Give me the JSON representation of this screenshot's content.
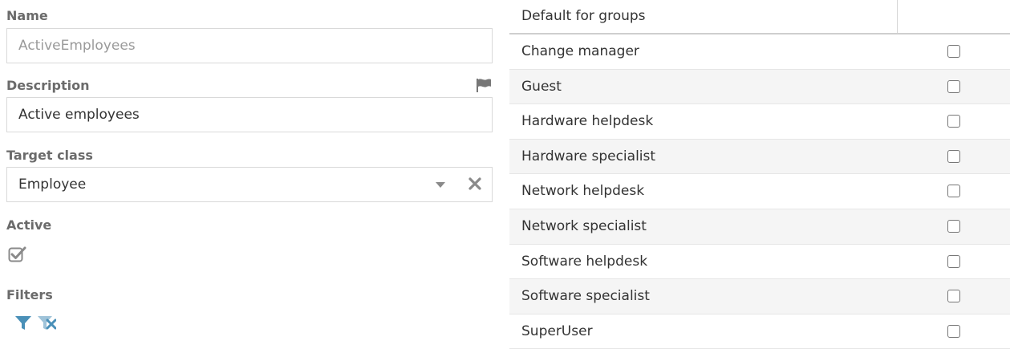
{
  "form": {
    "name": {
      "label": "Name",
      "value": "ActiveEmployees"
    },
    "description": {
      "label": "Description",
      "value": "Active employees"
    },
    "target_class": {
      "label": "Target class",
      "value": "Employee"
    },
    "active": {
      "label": "Active",
      "checked": true
    },
    "filters": {
      "label": "Filters"
    }
  },
  "grid": {
    "header": "Default for groups",
    "rows": [
      {
        "name": "Change manager",
        "checked": false
      },
      {
        "name": "Guest",
        "checked": false
      },
      {
        "name": "Hardware helpdesk",
        "checked": false
      },
      {
        "name": "Hardware specialist",
        "checked": false
      },
      {
        "name": "Network helpdesk",
        "checked": false
      },
      {
        "name": "Network specialist",
        "checked": false
      },
      {
        "name": "Software helpdesk",
        "checked": false
      },
      {
        "name": "Software specialist",
        "checked": false
      },
      {
        "name": "SuperUser",
        "checked": false
      }
    ]
  },
  "colors": {
    "accent": "#4a90b8",
    "label": "#6b6b6b",
    "border": "#d9d9d9",
    "alt_row": "#f5f5f5"
  }
}
